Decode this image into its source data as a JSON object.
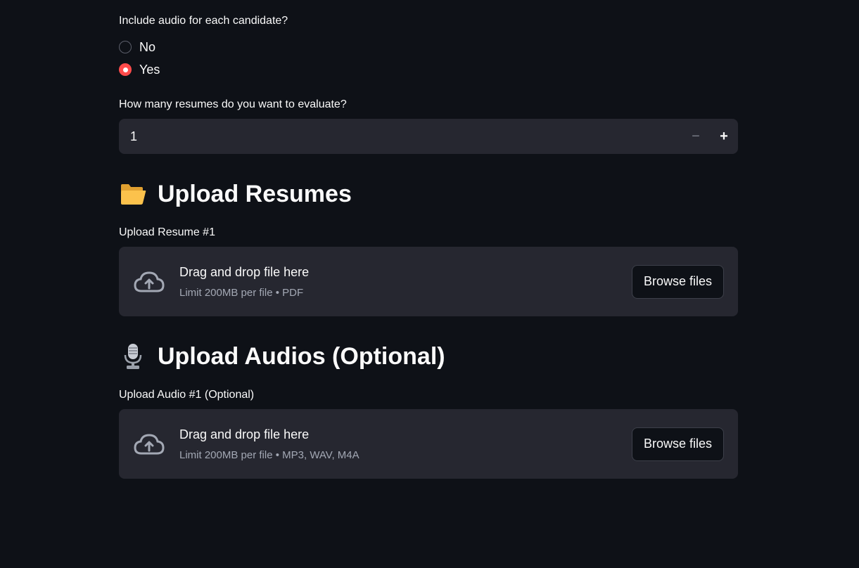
{
  "audio_question": {
    "label": "Include audio for each candidate?",
    "options": [
      "No",
      "Yes"
    ],
    "selected": "Yes"
  },
  "resume_count": {
    "label": "How many resumes do you want to evaluate?",
    "value": "1",
    "minus_label": "−",
    "plus_label": "+"
  },
  "resumes_section": {
    "title": "Upload Resumes",
    "uploader_label": "Upload Resume #1",
    "drop_text": "Drag and drop file here",
    "limit_text": "Limit 200MB per file • PDF",
    "button_label": "Browse files"
  },
  "audios_section": {
    "title": "Upload Audios (Optional)",
    "uploader_label": "Upload Audio #1 (Optional)",
    "drop_text": "Drag and drop file here",
    "limit_text": "Limit 200MB per file • MP3, WAV, M4A",
    "button_label": "Browse files"
  },
  "colors": {
    "background": "#0e1117",
    "surface": "#262730",
    "accent": "#ff4b4b",
    "text": "#fafafa",
    "muted_text": "#a3a8b4"
  },
  "icons": {
    "folder": "open-folder-icon",
    "microphone": "studio-microphone-icon",
    "upload": "cloud-upload-icon"
  }
}
